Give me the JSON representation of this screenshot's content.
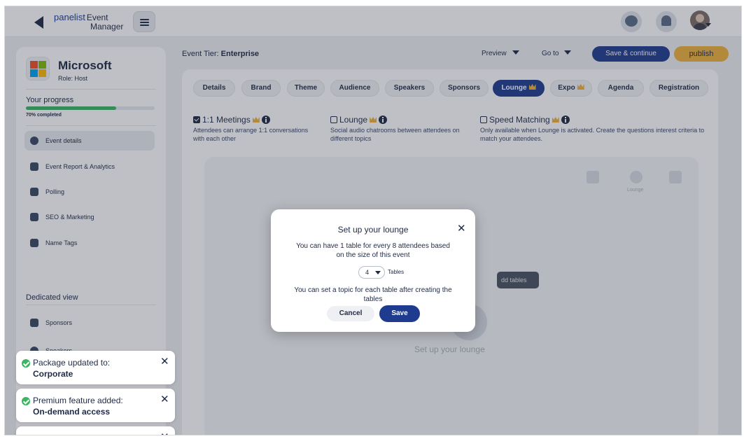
{
  "header": {
    "brand": "panelist",
    "brand_suffix": "Event",
    "brand_sub": "Manager"
  },
  "sidebar": {
    "org_name": "Microsoft",
    "role": "Role: Host",
    "progress_label": "Your progress",
    "progress_value": 0.7,
    "progress_text": "70% completed",
    "items": [
      {
        "label": "Event details",
        "icon": "info-icon"
      },
      {
        "label": "Event Report & Analytics",
        "icon": "users-chart-icon"
      },
      {
        "label": "Polling",
        "icon": "polling-icon"
      },
      {
        "label": "SEO & Marketing",
        "icon": "seo-icon"
      },
      {
        "label": "Name Tags",
        "icon": "name-tag-icon"
      }
    ],
    "dedicated_label": "Dedicated view",
    "dedicated_items": [
      {
        "label": "Sponsors",
        "icon": "sponsors-icon"
      },
      {
        "label": "Speakers",
        "icon": "speaker-icon"
      }
    ]
  },
  "toasts": [
    {
      "line1": "Package updated to:",
      "line2": "Corporate"
    },
    {
      "line1": "Premium feature added:",
      "line2": "On-demand access"
    }
  ],
  "main": {
    "tier_label": "Event Tier:",
    "tier_value": "Enterprise",
    "preview": "Preview",
    "goto": "Go to",
    "save_continue": "Save & continue",
    "publish": "publish",
    "tabs": [
      {
        "label": "Details"
      },
      {
        "label": "Brand"
      },
      {
        "label": "Theme"
      },
      {
        "label": "Audience"
      },
      {
        "label": "Speakers"
      },
      {
        "label": "Sponsors"
      },
      {
        "label": "Lounge",
        "active": true,
        "premium": true
      },
      {
        "label": "Expo",
        "premium": true
      },
      {
        "label": "Agenda"
      },
      {
        "label": "Registration"
      }
    ],
    "features": [
      {
        "title": "1:1 Meetings",
        "checked": true,
        "desc": "Attendees can arrange 1:1 conversations with each other"
      },
      {
        "title": "Lounge",
        "checked": false,
        "desc": "Social audio chatrooms between attendees on different topics"
      },
      {
        "title": "Speed Matching",
        "checked": false,
        "desc": "Only available when Lounge is activated. Create the questions interest criteria to match your attendees."
      }
    ],
    "stage_icon_label": "Lounge",
    "tooltip": "dd tables",
    "stage_caption": "Set up your lounge"
  },
  "modal": {
    "title": "Set up your lounge",
    "text1": "You can have 1 table for every 8 attendees based on the size of this event",
    "tables_value": "4",
    "tables_label": "Tables",
    "text2": "You can set a topic for each table after creating the tables",
    "cancel": "Cancel",
    "save": "Save"
  },
  "colors": {
    "accent": "#1f3b8f",
    "publish": "#f0b13c",
    "success": "#3cb563",
    "text": "#1f2a44"
  }
}
